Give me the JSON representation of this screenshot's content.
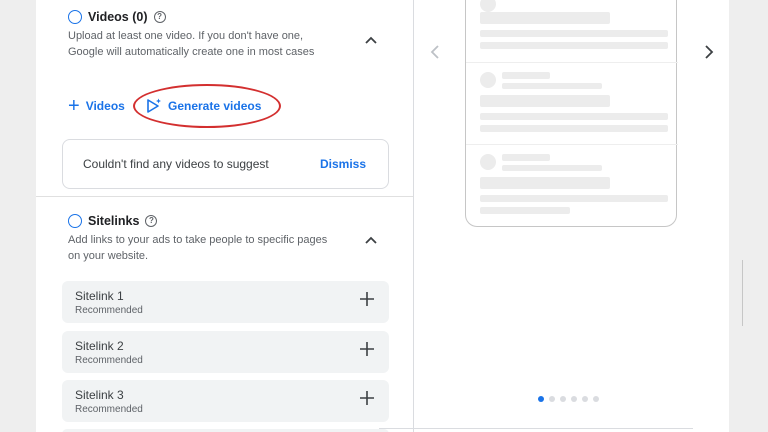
{
  "videos": {
    "title": "Videos (0)",
    "description": "Upload at least one video. If you don't have one, Google will automatically create one in most cases",
    "add_label": "Videos",
    "generate_label": "Generate videos",
    "suggest_message": "Couldn't find any videos to suggest",
    "dismiss_label": "Dismiss"
  },
  "sitelinks": {
    "title": "Sitelinks",
    "description": "Add links to your ads to take people to specific pages on your website.",
    "items": [
      {
        "label": "Sitelink 1",
        "sub": "Recommended"
      },
      {
        "label": "Sitelink 2",
        "sub": "Recommended"
      },
      {
        "label": "Sitelink 3",
        "sub": "Recommended"
      }
    ]
  },
  "preview": {
    "page_count": 6,
    "active_page": 1
  },
  "icons": {
    "help": "help-circle-icon",
    "collapse": "chevron-up-icon",
    "add": "plus-icon",
    "generate": "sparkle-play-icon",
    "prev": "chevron-left-icon",
    "next": "chevron-right-icon"
  },
  "colors": {
    "accent": "#1a73e8",
    "highlight_ellipse": "#d32f2f"
  }
}
